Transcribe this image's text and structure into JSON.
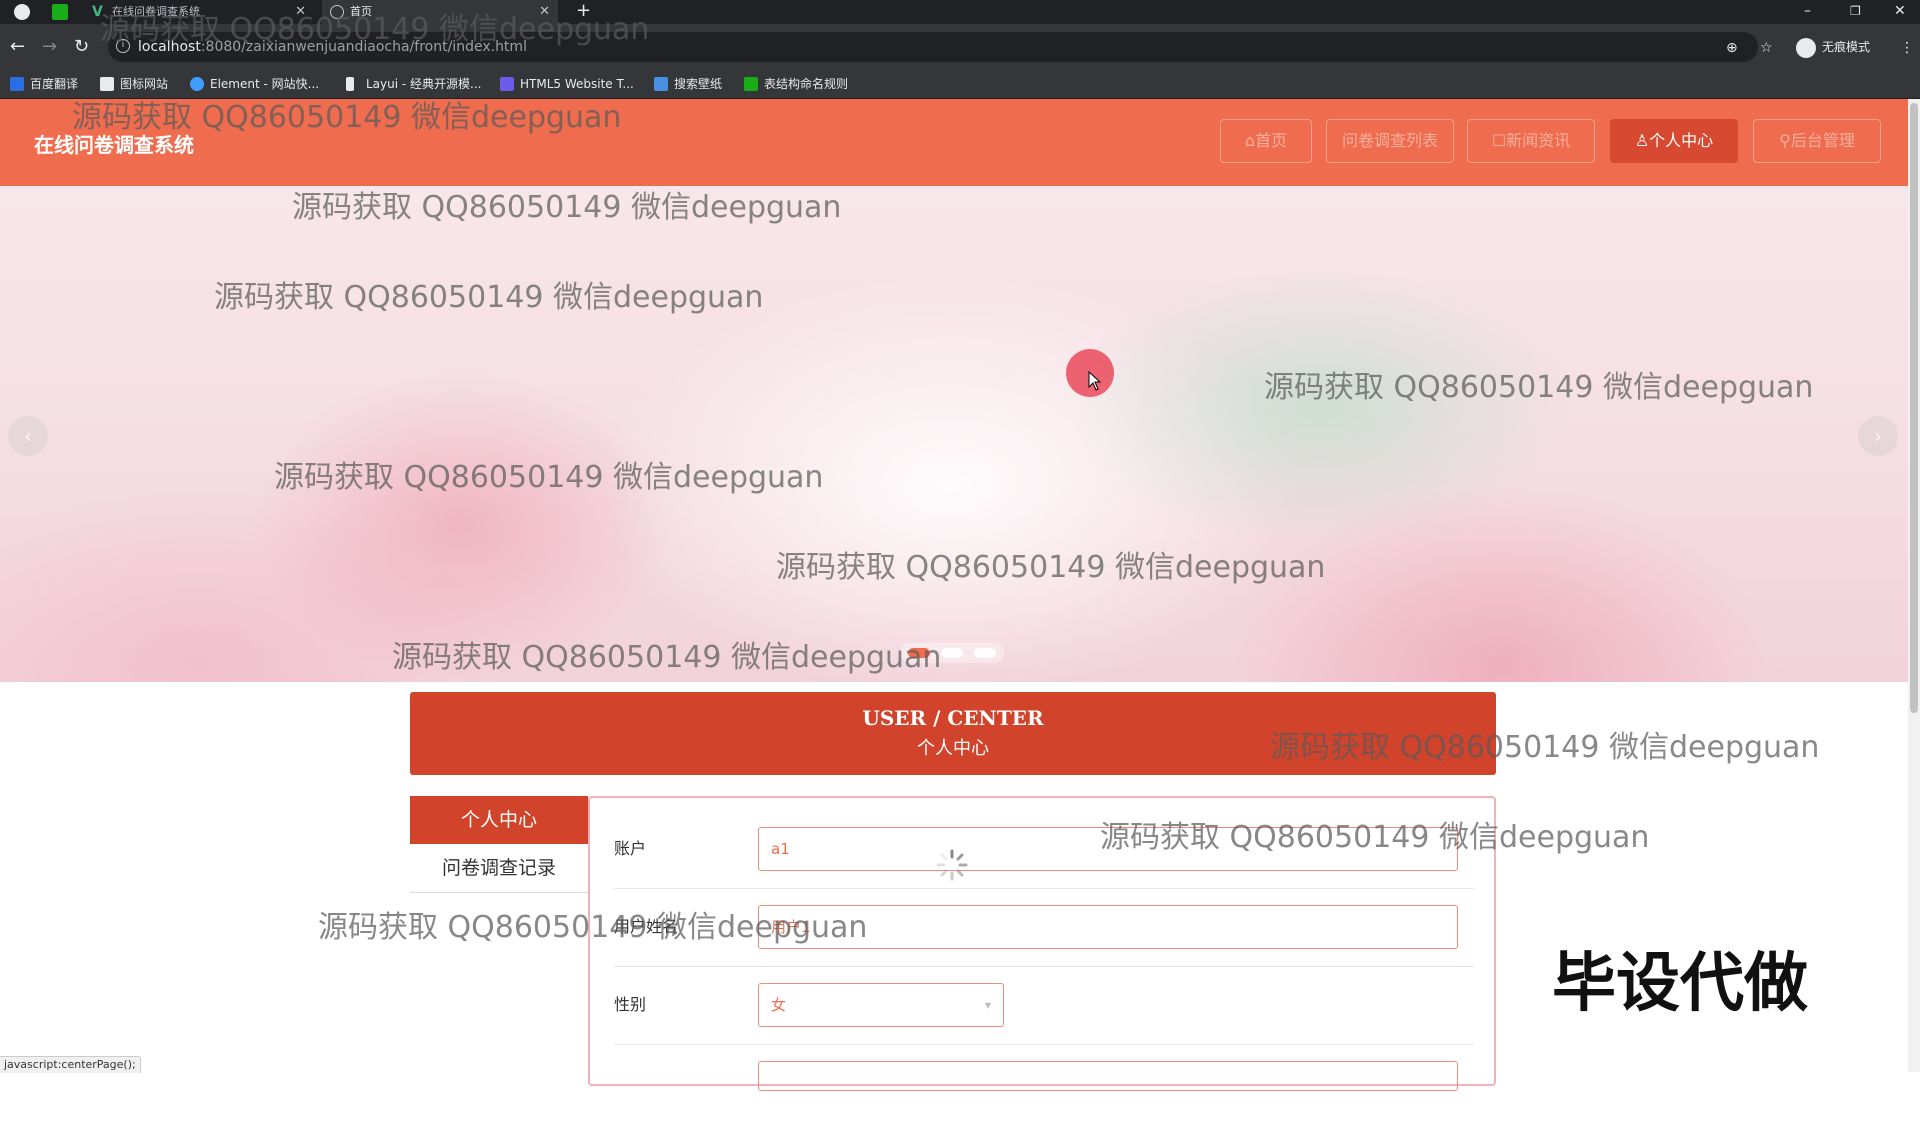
{
  "browser": {
    "tabs": [
      {
        "title": "在线问卷调查系统",
        "active": false
      },
      {
        "title": "首页",
        "active": true
      }
    ],
    "new_tab": "+",
    "window_controls": {
      "minimize": "–",
      "restore": "❐",
      "close": "✕"
    },
    "url_host": "localhost",
    "url_rest": ":8080/zaixianwenjuandiaocha/front/index.html",
    "incognito_label": "无痕模式",
    "bookmarks": [
      {
        "label": "百度翻译",
        "color": "#2b6de5"
      },
      {
        "label": "图标网站",
        "color": "#e8eaed"
      },
      {
        "label": "Element - 网站快...",
        "color": "#409eff"
      },
      {
        "label": "Layui - 经典开源模...",
        "color": "#e8eaed"
      },
      {
        "label": "HTML5 Website T...",
        "color": "#6c5ce7"
      },
      {
        "label": "搜索壁纸",
        "color": "#4a90e2"
      },
      {
        "label": "表结构命名规则",
        "color": "#1aad19"
      }
    ]
  },
  "site": {
    "title": "在线问卷调查系统",
    "accent": "#ef6c4e",
    "accent_dark": "#d2432b",
    "nav": [
      {
        "label": "⌂首页",
        "active": false
      },
      {
        "label": "问卷调查列表",
        "active": false
      },
      {
        "label": "☐新闻资讯",
        "active": false
      },
      {
        "label": "♙个人中心",
        "active": true
      },
      {
        "label": "⚲后台管理",
        "active": false
      }
    ]
  },
  "banner": {
    "prev_icon": "‹",
    "next_icon": "›",
    "slide_count": 3,
    "active_slide": 1
  },
  "center": {
    "title_en": "USER / CENTER",
    "title_cn": "个人中心",
    "menu": [
      {
        "label": "个人中心",
        "active": true
      },
      {
        "label": "问卷调查记录",
        "active": false
      }
    ],
    "form": {
      "account_label": "账户",
      "account_value": "a1",
      "name_label": "用户姓名",
      "name_value": "用户1",
      "gender_label": "性别",
      "gender_value": "女"
    }
  },
  "status_text": "javascript:centerPage();",
  "watermark_text": "源码获取 QQ86050149 微信deepguan",
  "promo_text": "毕设代做"
}
